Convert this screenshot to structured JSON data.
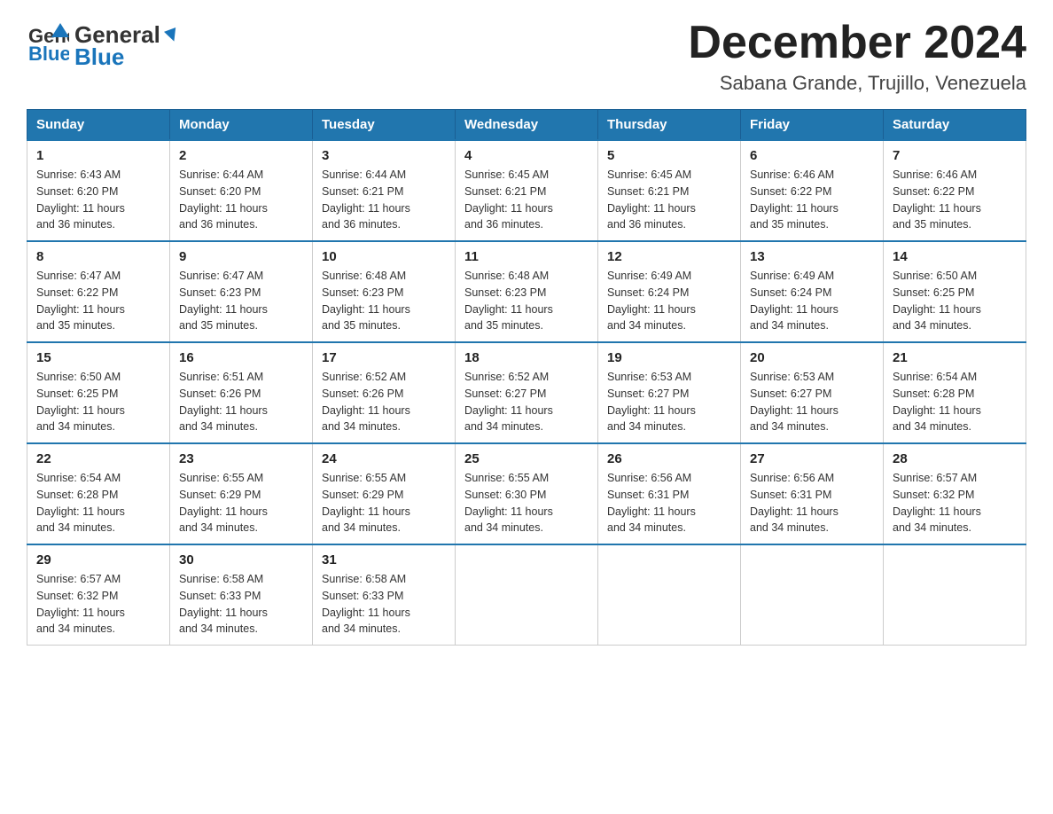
{
  "header": {
    "title": "December 2024",
    "location": "Sabana Grande, Trujillo, Venezuela",
    "logo_line1": "General",
    "logo_line2": "Blue"
  },
  "weekdays": [
    "Sunday",
    "Monday",
    "Tuesday",
    "Wednesday",
    "Thursday",
    "Friday",
    "Saturday"
  ],
  "weeks": [
    [
      {
        "day": "1",
        "sunrise": "6:43 AM",
        "sunset": "6:20 PM",
        "daylight": "11 hours and 36 minutes."
      },
      {
        "day": "2",
        "sunrise": "6:44 AM",
        "sunset": "6:20 PM",
        "daylight": "11 hours and 36 minutes."
      },
      {
        "day": "3",
        "sunrise": "6:44 AM",
        "sunset": "6:21 PM",
        "daylight": "11 hours and 36 minutes."
      },
      {
        "day": "4",
        "sunrise": "6:45 AM",
        "sunset": "6:21 PM",
        "daylight": "11 hours and 36 minutes."
      },
      {
        "day": "5",
        "sunrise": "6:45 AM",
        "sunset": "6:21 PM",
        "daylight": "11 hours and 36 minutes."
      },
      {
        "day": "6",
        "sunrise": "6:46 AM",
        "sunset": "6:22 PM",
        "daylight": "11 hours and 35 minutes."
      },
      {
        "day": "7",
        "sunrise": "6:46 AM",
        "sunset": "6:22 PM",
        "daylight": "11 hours and 35 minutes."
      }
    ],
    [
      {
        "day": "8",
        "sunrise": "6:47 AM",
        "sunset": "6:22 PM",
        "daylight": "11 hours and 35 minutes."
      },
      {
        "day": "9",
        "sunrise": "6:47 AM",
        "sunset": "6:23 PM",
        "daylight": "11 hours and 35 minutes."
      },
      {
        "day": "10",
        "sunrise": "6:48 AM",
        "sunset": "6:23 PM",
        "daylight": "11 hours and 35 minutes."
      },
      {
        "day": "11",
        "sunrise": "6:48 AM",
        "sunset": "6:23 PM",
        "daylight": "11 hours and 35 minutes."
      },
      {
        "day": "12",
        "sunrise": "6:49 AM",
        "sunset": "6:24 PM",
        "daylight": "11 hours and 34 minutes."
      },
      {
        "day": "13",
        "sunrise": "6:49 AM",
        "sunset": "6:24 PM",
        "daylight": "11 hours and 34 minutes."
      },
      {
        "day": "14",
        "sunrise": "6:50 AM",
        "sunset": "6:25 PM",
        "daylight": "11 hours and 34 minutes."
      }
    ],
    [
      {
        "day": "15",
        "sunrise": "6:50 AM",
        "sunset": "6:25 PM",
        "daylight": "11 hours and 34 minutes."
      },
      {
        "day": "16",
        "sunrise": "6:51 AM",
        "sunset": "6:26 PM",
        "daylight": "11 hours and 34 minutes."
      },
      {
        "day": "17",
        "sunrise": "6:52 AM",
        "sunset": "6:26 PM",
        "daylight": "11 hours and 34 minutes."
      },
      {
        "day": "18",
        "sunrise": "6:52 AM",
        "sunset": "6:27 PM",
        "daylight": "11 hours and 34 minutes."
      },
      {
        "day": "19",
        "sunrise": "6:53 AM",
        "sunset": "6:27 PM",
        "daylight": "11 hours and 34 minutes."
      },
      {
        "day": "20",
        "sunrise": "6:53 AM",
        "sunset": "6:27 PM",
        "daylight": "11 hours and 34 minutes."
      },
      {
        "day": "21",
        "sunrise": "6:54 AM",
        "sunset": "6:28 PM",
        "daylight": "11 hours and 34 minutes."
      }
    ],
    [
      {
        "day": "22",
        "sunrise": "6:54 AM",
        "sunset": "6:28 PM",
        "daylight": "11 hours and 34 minutes."
      },
      {
        "day": "23",
        "sunrise": "6:55 AM",
        "sunset": "6:29 PM",
        "daylight": "11 hours and 34 minutes."
      },
      {
        "day": "24",
        "sunrise": "6:55 AM",
        "sunset": "6:29 PM",
        "daylight": "11 hours and 34 minutes."
      },
      {
        "day": "25",
        "sunrise": "6:55 AM",
        "sunset": "6:30 PM",
        "daylight": "11 hours and 34 minutes."
      },
      {
        "day": "26",
        "sunrise": "6:56 AM",
        "sunset": "6:31 PM",
        "daylight": "11 hours and 34 minutes."
      },
      {
        "day": "27",
        "sunrise": "6:56 AM",
        "sunset": "6:31 PM",
        "daylight": "11 hours and 34 minutes."
      },
      {
        "day": "28",
        "sunrise": "6:57 AM",
        "sunset": "6:32 PM",
        "daylight": "11 hours and 34 minutes."
      }
    ],
    [
      {
        "day": "29",
        "sunrise": "6:57 AM",
        "sunset": "6:32 PM",
        "daylight": "11 hours and 34 minutes."
      },
      {
        "day": "30",
        "sunrise": "6:58 AM",
        "sunset": "6:33 PM",
        "daylight": "11 hours and 34 minutes."
      },
      {
        "day": "31",
        "sunrise": "6:58 AM",
        "sunset": "6:33 PM",
        "daylight": "11 hours and 34 minutes."
      },
      null,
      null,
      null,
      null
    ]
  ],
  "labels": {
    "sunrise": "Sunrise:",
    "sunset": "Sunset:",
    "daylight": "Daylight:"
  }
}
